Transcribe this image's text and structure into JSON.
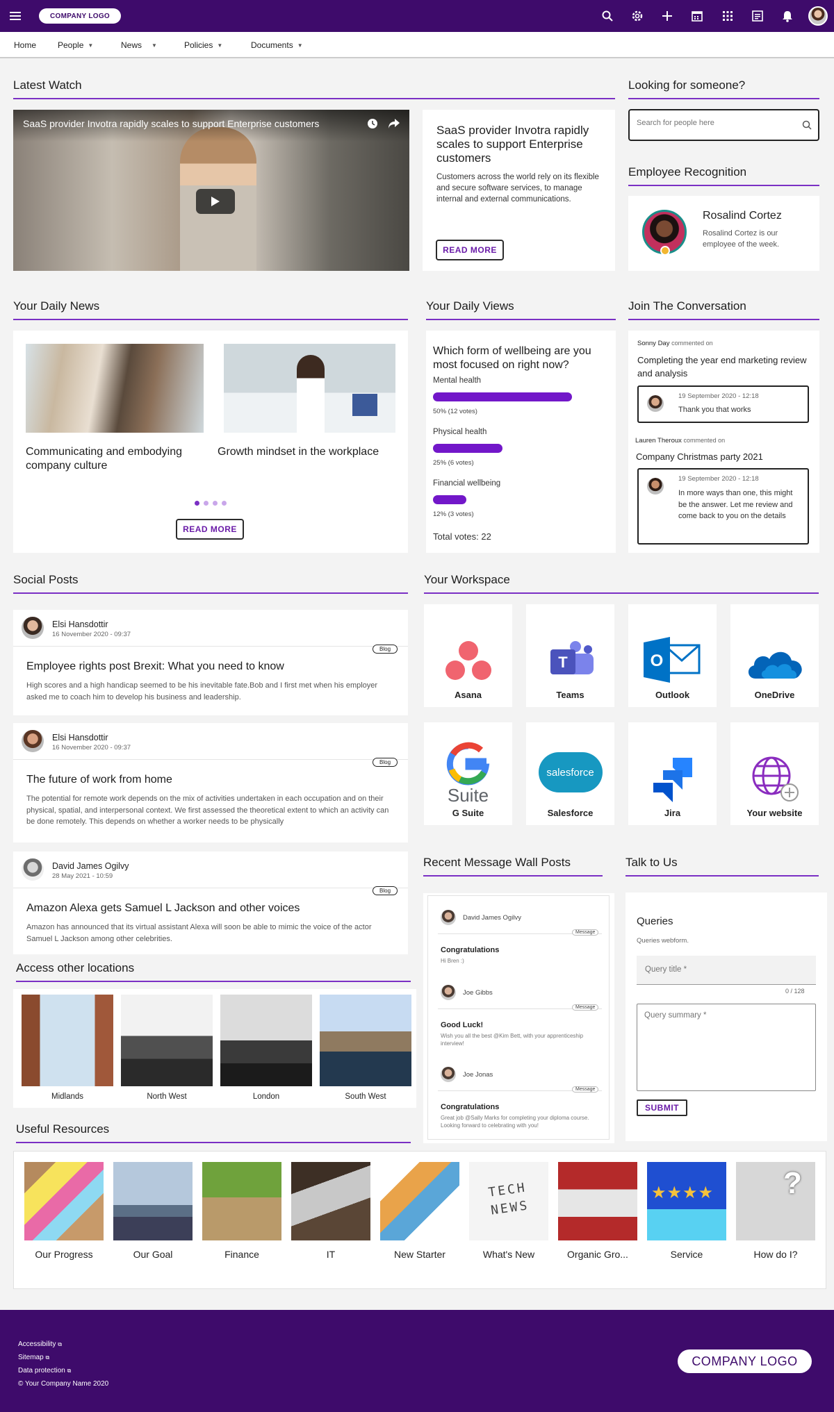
{
  "header": {
    "logo": "COMPANY LOGO",
    "icons": [
      "menu-icon",
      "search-icon",
      "gear-icon",
      "plus-icon",
      "calendar-icon",
      "apps-grid-icon",
      "news-icon",
      "bell-icon",
      "avatar"
    ]
  },
  "nav": {
    "items": [
      {
        "label": "Home",
        "dropdown": false
      },
      {
        "label": "People",
        "dropdown": true
      },
      {
        "label": "News",
        "dropdown": true
      },
      {
        "label": "Policies",
        "dropdown": true
      },
      {
        "label": "Documents",
        "dropdown": true
      }
    ]
  },
  "latest_watch": {
    "heading": "Latest Watch",
    "video_title": "SaaS provider Invotra rapidly scales to support Enterprise customers",
    "article_title": "SaaS provider Invotra rapidly scales to support Enterprise customers",
    "article_body": "Customers across the world rely on its flexible and secure software services, to manage internal and external communications.",
    "read_more": "READ MORE"
  },
  "people_search": {
    "heading": "Looking for someone?",
    "placeholder": "Search for people here"
  },
  "recognition": {
    "heading": "Employee Recognition",
    "name": "Rosalind Cortez",
    "text": "Rosalind Cortez is our employee of the week."
  },
  "daily_news": {
    "heading": "Your Daily News",
    "items": [
      {
        "title": "Communicating and embodying company culture"
      },
      {
        "title": "Growth mindset in the workplace"
      }
    ],
    "read_more": "READ MORE"
  },
  "daily_views": {
    "heading": "Your Daily Views",
    "question": "Which form of wellbeing are you most focused on right now?",
    "options": [
      {
        "label": "Mental health",
        "result": "50% (12 votes)",
        "percent": 50
      },
      {
        "label": "Physical health",
        "result": "25% (6 votes)",
        "percent": 25
      },
      {
        "label": "Financial wellbeing",
        "result": "12% (3 votes)",
        "percent": 12
      }
    ],
    "total": "Total votes: 22"
  },
  "conversation": {
    "heading": "Join The Conversation",
    "threads": [
      {
        "author": "Sonny Day",
        "action": "commented on",
        "topic": "Completing the year end marketing review and analysis",
        "date": "19 September 2020 - 12:18",
        "reply": "Thank you that works"
      },
      {
        "author": "Lauren Theroux",
        "action": "commented on",
        "topic": "Company Christmas party 2021",
        "date": "19 September 2020 - 12:18",
        "reply": "In more ways than one, this might be the answer. Let me review and come back to you on the details"
      }
    ]
  },
  "social": {
    "heading": "Social Posts",
    "posts": [
      {
        "author": "Elsi Hansdottir",
        "date": "16 November 2020 - 09:37",
        "tag": "Blog",
        "title": "Employee rights post Brexit: What you need to know",
        "body": "High scores and a high handicap seemed to be his inevitable fate.Bob and I first met when his employer asked me to coach him to develop his business and leadership."
      },
      {
        "author": "Elsi Hansdottir",
        "date": "16 November 2020 - 09:37",
        "tag": "Blog",
        "title": "The future of work from home",
        "body": "The potential for remote work depends on the mix of activities undertaken in each occupation and on their physical, spatial, and interpersonal context. We first assessed the theoretical extent to which an activity can be done remotely. This depends on whether a worker needs to be physically"
      },
      {
        "author": "David James Ogilvy",
        "date": "28 May 2021 - 10:59",
        "tag": "Blog",
        "title": "Amazon Alexa gets Samuel L Jackson and other voices",
        "body": "Amazon has announced that its virtual assistant Alexa will soon be able to mimic the voice of the actor Samuel L Jackson among other celebrities."
      }
    ]
  },
  "workspace": {
    "heading": "Your Workspace",
    "apps": [
      {
        "label": "Asana"
      },
      {
        "label": "Teams"
      },
      {
        "label": "Outlook"
      },
      {
        "label": "OneDrive"
      },
      {
        "label": "G Suite"
      },
      {
        "label": "Salesforce"
      },
      {
        "label": "Jira"
      },
      {
        "label": "Your website"
      }
    ],
    "gsuite_text": "Suite",
    "salesforce_text": "salesforce"
  },
  "locations": {
    "heading": "Access other locations",
    "items": [
      {
        "label": "Midlands"
      },
      {
        "label": "North West"
      },
      {
        "label": "London"
      },
      {
        "label": "South West"
      }
    ]
  },
  "message_wall": {
    "heading": "Recent Message Wall Posts",
    "posts": [
      {
        "author": "David James Ogilvy",
        "tag": "Message",
        "title": "Congratulations",
        "body": "Hi Bren :)"
      },
      {
        "author": "Joe Gibbs",
        "tag": "Message",
        "title": "Good Luck!",
        "body": "Wish you all the best @Kim Bett, with your apprenticeship interview!"
      },
      {
        "author": "Joe Jonas",
        "tag": "Message",
        "title": "Congratulations",
        "body": "Great job @Sally Marks for completing your diploma course. Looking forward to celebrating with you!"
      }
    ]
  },
  "talk": {
    "heading": "Talk to Us",
    "form_title": "Queries",
    "form_sub": "Queries webform.",
    "title_placeholder": "Query title *",
    "counter": "0 / 128",
    "summary_placeholder": "Query summary *",
    "submit": "SUBMIT"
  },
  "resources": {
    "heading": "Useful Resources",
    "items": [
      {
        "label": "Our Progress"
      },
      {
        "label": "Our Goal"
      },
      {
        "label": "Finance"
      },
      {
        "label": "IT"
      },
      {
        "label": "New Starter"
      },
      {
        "label": "What's New"
      },
      {
        "label": "Organic Gro..."
      },
      {
        "label": "Service"
      },
      {
        "label": "How do I?"
      }
    ],
    "tech_news": "TECH NEWS"
  },
  "footer": {
    "links": [
      "Accessibility",
      "Sitemap",
      "Data protection"
    ],
    "copyright": "© Your Company Name 2020",
    "logo": "COMPANY LOGO"
  },
  "colors": {
    "brand": "#3e0b6b",
    "accent": "#7a2fc4",
    "bar": "#7217c9"
  }
}
